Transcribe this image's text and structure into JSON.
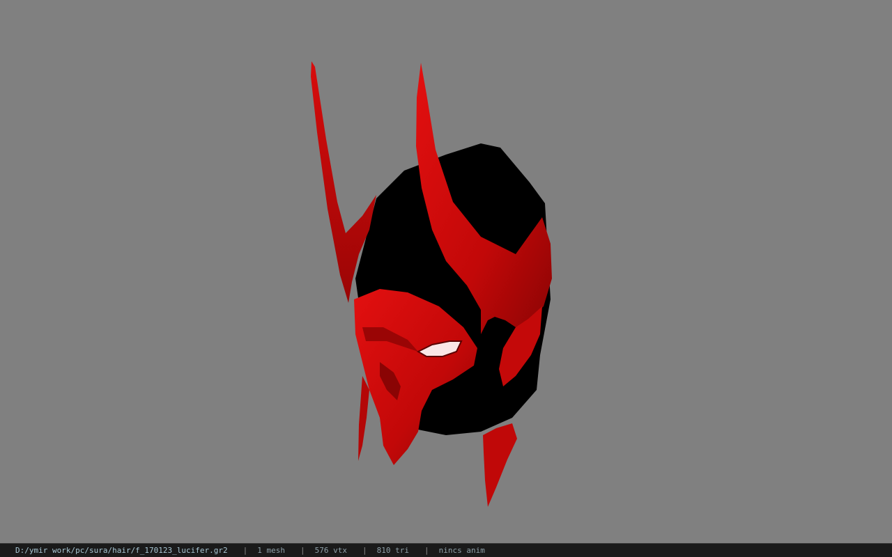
{
  "viewport": {
    "background_color": "#808080",
    "model_primary_color": "#d40a0a",
    "model_shadow_color": "#000000"
  },
  "statusbar": {
    "file_path": "D:/ymir work/pc/sura/hair/f_170123_lucifer.gr2",
    "separator": "|",
    "mesh_count": "1 mesh",
    "vertex_count": "576 vtx",
    "triangle_count": "810 tri",
    "anim_status": "nincs anim"
  }
}
